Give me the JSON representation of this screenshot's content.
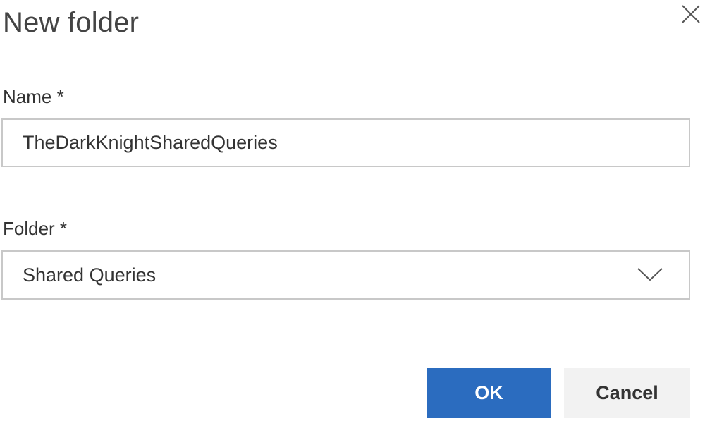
{
  "dialog": {
    "title": "New folder",
    "close_icon": "close-icon"
  },
  "name_field": {
    "label": "Name *",
    "value": "TheDarkKnightSharedQueries"
  },
  "folder_field": {
    "label": "Folder *",
    "selected": "Shared Queries",
    "dropdown_icon": "chevron-down-icon"
  },
  "buttons": {
    "ok_label": "OK",
    "cancel_label": "Cancel"
  },
  "colors": {
    "primary": "#2b6cbf",
    "secondary_bg": "#f2f2f2",
    "border": "#c8c8c8"
  }
}
